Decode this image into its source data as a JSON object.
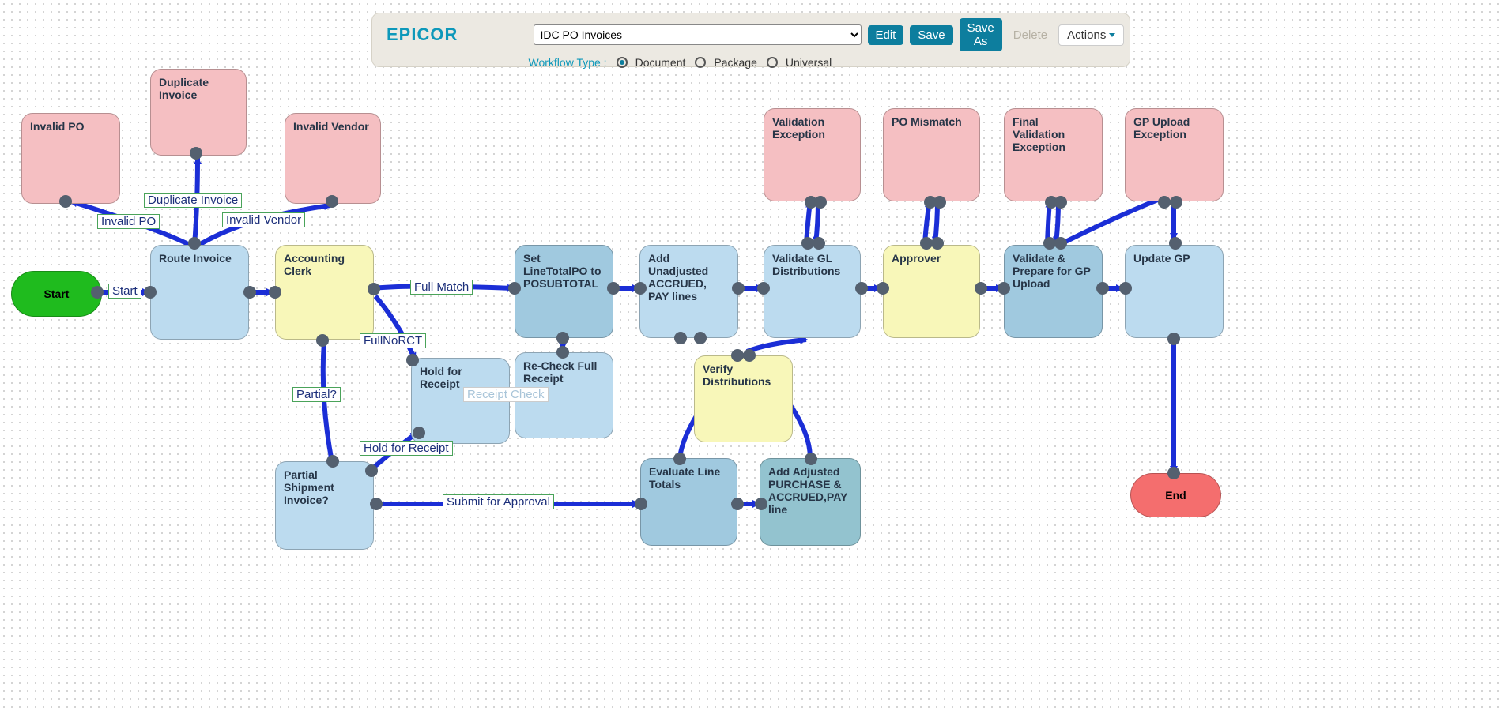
{
  "toolbar": {
    "brand": "EPICOR",
    "workflow_selected": "IDC PO Invoices",
    "buttons": {
      "edit": "Edit",
      "save": "Save",
      "save_as": "Save As",
      "delete": "Delete",
      "actions": "Actions"
    },
    "workflow_type_label": "Workflow Type :",
    "radios": {
      "document": "Document",
      "package": "Package",
      "universal": "Universal"
    },
    "radio_selected": "document"
  },
  "nodes": {
    "invalid_po": {
      "label": "Invalid PO"
    },
    "duplicate_inv": {
      "label": "Duplicate Invoice"
    },
    "invalid_vendor": {
      "label": "Invalid Vendor"
    },
    "validation_ex": {
      "label": "Validation Exception"
    },
    "po_mismatch": {
      "label": "PO Mismatch"
    },
    "final_val_ex": {
      "label": "Final\nValidation\nException"
    },
    "gp_upload_ex": {
      "label": "GP Upload Exception"
    },
    "start": {
      "label": "Start"
    },
    "route_invoice": {
      "label": "Route Invoice"
    },
    "acct_clerk": {
      "label": "Accounting Clerk"
    },
    "set_linetotal": {
      "label": "Set LineTotalPO to POSUBTOTAL"
    },
    "add_unadjusted": {
      "label": "Add Unadjusted ACCRUED, PAY lines"
    },
    "validate_gl": {
      "label": "Validate GL Distributions"
    },
    "approver": {
      "label": "Approver"
    },
    "validate_prepare": {
      "label": "Validate & Prepare for GP Upload"
    },
    "update_gp": {
      "label": "Update GP"
    },
    "hold_receipt": {
      "label": "Hold for Receipt"
    },
    "recheck_full": {
      "label": "Re-Check Full Receipt"
    },
    "verify_dist": {
      "label": "Verify Distributions"
    },
    "partial_ship": {
      "label": "Partial Shipment Invoice?"
    },
    "eval_line": {
      "label": "Evaluate Line Totals"
    },
    "add_adjusted": {
      "label": "Add Adjusted PURCHASE & ACCRUED,PAY line"
    },
    "end": {
      "label": "End"
    }
  },
  "edge_labels": {
    "invalid_po_lbl": "Invalid PO",
    "dup_inv_lbl": "Duplicate Invoice",
    "invalid_vendor_lbl": "Invalid Vendor",
    "start_lbl": "Start",
    "full_match": "Full Match",
    "full_no_rct": "FullNoRCT",
    "partial_q": "Partial?",
    "hold_for_receipt": "Hold for Receipt",
    "submit_approval": "Submit for Approval",
    "receipt_check": "Receipt Check"
  }
}
